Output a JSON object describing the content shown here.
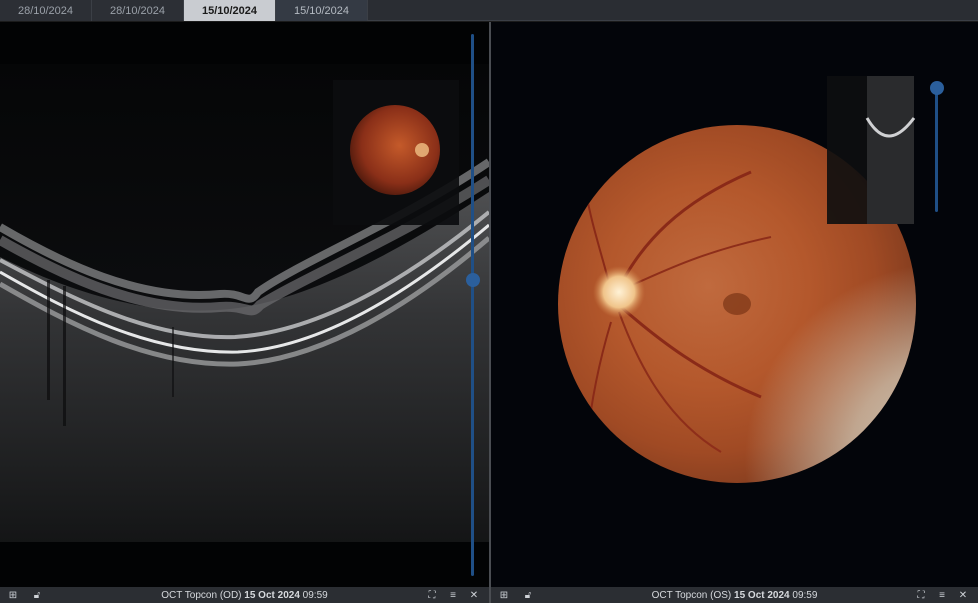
{
  "tabs": [
    {
      "label": "28/10/2024",
      "state": "normal"
    },
    {
      "label": "28/10/2024",
      "state": "normal"
    },
    {
      "label": "15/10/2024",
      "state": "active"
    },
    {
      "label": "15/10/2024",
      "state": "dim"
    }
  ],
  "left_viewer": {
    "status": {
      "device": "OCT Topcon (OD)",
      "date": "15 Oct 2024",
      "time": "09:59"
    },
    "slider_level": 0.46
  },
  "right_viewer": {
    "status": {
      "device": "OCT Topcon (OS)",
      "date": "15 Oct 2024",
      "time": "09:59"
    },
    "slider_level": 0.0
  },
  "icons": {
    "left": [
      "add-panel-icon",
      "lock-icon"
    ],
    "right": [
      "fullscreen-icon",
      "menu-icon",
      "close-icon"
    ]
  },
  "colors": {
    "accent": "#2b5f9c",
    "tab_active_bg": "#c9ccd1",
    "background": "#020304"
  }
}
